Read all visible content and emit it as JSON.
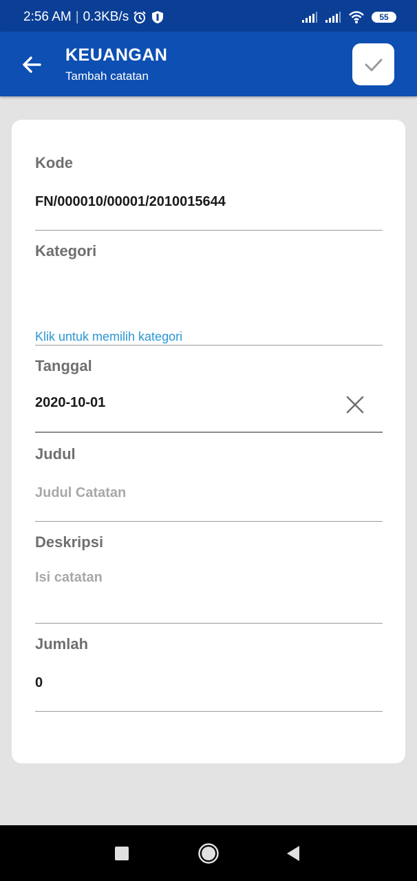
{
  "status_bar": {
    "time": "2:56 AM",
    "net_speed": "0.3KB/s",
    "battery": "55",
    "icons": [
      "alarm-icon",
      "shield-icon",
      "signal-icon",
      "signal-icon",
      "wifi-icon",
      "battery-icon"
    ]
  },
  "app_bar": {
    "title": "KEUANGAN",
    "subtitle": "Tambah catatan",
    "back_icon": "arrow-left-icon",
    "save_icon": "check-icon"
  },
  "form": {
    "kode": {
      "label": "Kode",
      "value": "FN/000010/00001/2010015644"
    },
    "kategori": {
      "label": "Kategori",
      "link": "Klik untuk memilih kategori"
    },
    "tanggal": {
      "label": "Tanggal",
      "value": "2020-10-01"
    },
    "judul": {
      "label": "Judul",
      "placeholder": "Judul Catatan"
    },
    "deskripsi": {
      "label": "Deskripsi",
      "placeholder": "Isi catatan"
    },
    "jumlah": {
      "label": "Jumlah",
      "value": "0"
    }
  },
  "nav_bar": {
    "icons": [
      "recents-icon",
      "home-icon",
      "back-icon"
    ]
  },
  "colors": {
    "primary": "#0d4fb2",
    "status_bar": "#0b3f96",
    "link": "#2996d4",
    "background": "#e3e3e3"
  }
}
